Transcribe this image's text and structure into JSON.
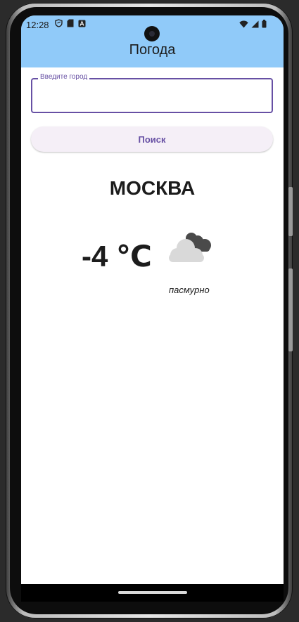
{
  "status_bar": {
    "time": "12:28"
  },
  "app": {
    "title": "Погода"
  },
  "search": {
    "label": "Введите город",
    "value": "",
    "button_label": "Поиск"
  },
  "weather": {
    "city": "МОСКВА",
    "temperature": "-4 ℃",
    "condition": "пасмурно",
    "icon": "overcast-cloud-icon"
  },
  "colors": {
    "appbar": "#90caf9",
    "accent": "#6750a4",
    "button_bg": "#f5eff7"
  }
}
